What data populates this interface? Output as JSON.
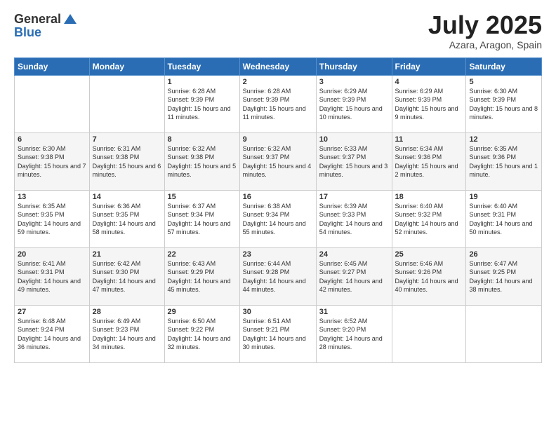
{
  "header": {
    "logo_line1": "General",
    "logo_line2": "Blue",
    "month": "July 2025",
    "location": "Azara, Aragon, Spain"
  },
  "weekdays": [
    "Sunday",
    "Monday",
    "Tuesday",
    "Wednesday",
    "Thursday",
    "Friday",
    "Saturday"
  ],
  "weeks": [
    [
      null,
      null,
      {
        "day": 1,
        "sunrise": "6:28 AM",
        "sunset": "9:39 PM",
        "daylight": "15 hours and 11 minutes."
      },
      {
        "day": 2,
        "sunrise": "6:28 AM",
        "sunset": "9:39 PM",
        "daylight": "15 hours and 11 minutes."
      },
      {
        "day": 3,
        "sunrise": "6:29 AM",
        "sunset": "9:39 PM",
        "daylight": "15 hours and 10 minutes."
      },
      {
        "day": 4,
        "sunrise": "6:29 AM",
        "sunset": "9:39 PM",
        "daylight": "15 hours and 9 minutes."
      },
      {
        "day": 5,
        "sunrise": "6:30 AM",
        "sunset": "9:39 PM",
        "daylight": "15 hours and 8 minutes."
      }
    ],
    [
      {
        "day": 6,
        "sunrise": "6:30 AM",
        "sunset": "9:38 PM",
        "daylight": "15 hours and 7 minutes."
      },
      {
        "day": 7,
        "sunrise": "6:31 AM",
        "sunset": "9:38 PM",
        "daylight": "15 hours and 6 minutes."
      },
      {
        "day": 8,
        "sunrise": "6:32 AM",
        "sunset": "9:38 PM",
        "daylight": "15 hours and 5 minutes."
      },
      {
        "day": 9,
        "sunrise": "6:32 AM",
        "sunset": "9:37 PM",
        "daylight": "15 hours and 4 minutes."
      },
      {
        "day": 10,
        "sunrise": "6:33 AM",
        "sunset": "9:37 PM",
        "daylight": "15 hours and 3 minutes."
      },
      {
        "day": 11,
        "sunrise": "6:34 AM",
        "sunset": "9:36 PM",
        "daylight": "15 hours and 2 minutes."
      },
      {
        "day": 12,
        "sunrise": "6:35 AM",
        "sunset": "9:36 PM",
        "daylight": "15 hours and 1 minute."
      }
    ],
    [
      {
        "day": 13,
        "sunrise": "6:35 AM",
        "sunset": "9:35 PM",
        "daylight": "14 hours and 59 minutes."
      },
      {
        "day": 14,
        "sunrise": "6:36 AM",
        "sunset": "9:35 PM",
        "daylight": "14 hours and 58 minutes."
      },
      {
        "day": 15,
        "sunrise": "6:37 AM",
        "sunset": "9:34 PM",
        "daylight": "14 hours and 57 minutes."
      },
      {
        "day": 16,
        "sunrise": "6:38 AM",
        "sunset": "9:34 PM",
        "daylight": "14 hours and 55 minutes."
      },
      {
        "day": 17,
        "sunrise": "6:39 AM",
        "sunset": "9:33 PM",
        "daylight": "14 hours and 54 minutes."
      },
      {
        "day": 18,
        "sunrise": "6:40 AM",
        "sunset": "9:32 PM",
        "daylight": "14 hours and 52 minutes."
      },
      {
        "day": 19,
        "sunrise": "6:40 AM",
        "sunset": "9:31 PM",
        "daylight": "14 hours and 50 minutes."
      }
    ],
    [
      {
        "day": 20,
        "sunrise": "6:41 AM",
        "sunset": "9:31 PM",
        "daylight": "14 hours and 49 minutes."
      },
      {
        "day": 21,
        "sunrise": "6:42 AM",
        "sunset": "9:30 PM",
        "daylight": "14 hours and 47 minutes."
      },
      {
        "day": 22,
        "sunrise": "6:43 AM",
        "sunset": "9:29 PM",
        "daylight": "14 hours and 45 minutes."
      },
      {
        "day": 23,
        "sunrise": "6:44 AM",
        "sunset": "9:28 PM",
        "daylight": "14 hours and 44 minutes."
      },
      {
        "day": 24,
        "sunrise": "6:45 AM",
        "sunset": "9:27 PM",
        "daylight": "14 hours and 42 minutes."
      },
      {
        "day": 25,
        "sunrise": "6:46 AM",
        "sunset": "9:26 PM",
        "daylight": "14 hours and 40 minutes."
      },
      {
        "day": 26,
        "sunrise": "6:47 AM",
        "sunset": "9:25 PM",
        "daylight": "14 hours and 38 minutes."
      }
    ],
    [
      {
        "day": 27,
        "sunrise": "6:48 AM",
        "sunset": "9:24 PM",
        "daylight": "14 hours and 36 minutes."
      },
      {
        "day": 28,
        "sunrise": "6:49 AM",
        "sunset": "9:23 PM",
        "daylight": "14 hours and 34 minutes."
      },
      {
        "day": 29,
        "sunrise": "6:50 AM",
        "sunset": "9:22 PM",
        "daylight": "14 hours and 32 minutes."
      },
      {
        "day": 30,
        "sunrise": "6:51 AM",
        "sunset": "9:21 PM",
        "daylight": "14 hours and 30 minutes."
      },
      {
        "day": 31,
        "sunrise": "6:52 AM",
        "sunset": "9:20 PM",
        "daylight": "14 hours and 28 minutes."
      },
      null,
      null
    ]
  ]
}
